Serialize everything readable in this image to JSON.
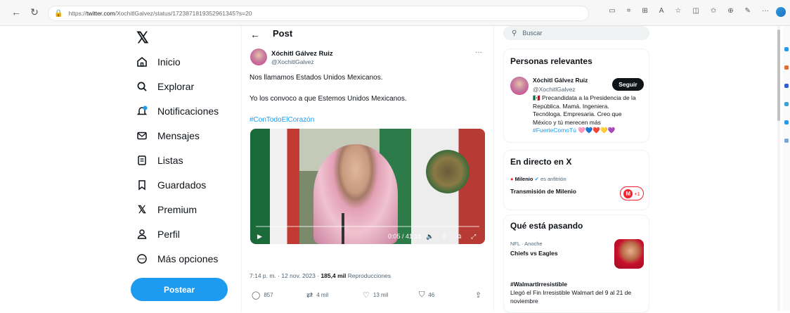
{
  "browser": {
    "url_prefix": "https://",
    "url_host": "twitter.com",
    "url_path": "/XochitlGalvez/status/1723871819352961345?s=20",
    "back_icon": "back-arrow-icon",
    "refresh_icon": "refresh-icon"
  },
  "sidebar": {
    "logo": "𝕏",
    "items": [
      {
        "label": "Inicio",
        "icon": "home-icon"
      },
      {
        "label": "Explorar",
        "icon": "search-icon"
      },
      {
        "label": "Notificaciones",
        "icon": "bell-icon"
      },
      {
        "label": "Mensajes",
        "icon": "mail-icon"
      },
      {
        "label": "Listas",
        "icon": "list-icon"
      },
      {
        "label": "Guardados",
        "icon": "bookmark-icon"
      },
      {
        "label": "Premium",
        "icon": "x-icon"
      },
      {
        "label": "Perfil",
        "icon": "person-icon"
      },
      {
        "label": "Más opciones",
        "icon": "more-circle-icon"
      }
    ],
    "post_button": "Postear"
  },
  "main": {
    "title": "Post",
    "author_name": "Xóchitl Gálvez Ruiz",
    "author_handle": "@XochitlGalvez",
    "text_line1": "Nos llamamos Estados Unidos Mexicanos.",
    "text_line2": "Yo los convoco a que Estemos Unidos Mexicanos.",
    "hashtag": "#ConTodoElCorazón",
    "video_time": "0:05 / 41:16",
    "meta_time": "7:14 p. m. · 12 nov. 2023 · ",
    "meta_views": "185,4 mil",
    "meta_views_label": " Reproducciones",
    "actions": {
      "replies": "857",
      "reposts": "4 mil",
      "likes": "13 mil",
      "bookmarks": "46"
    }
  },
  "right": {
    "search_placeholder": "Buscar",
    "relevant": {
      "title": "Personas relevantes",
      "name": "Xóchitl Gálvez Ruiz",
      "handle": "@XochitlGalvez",
      "follow": "Seguir",
      "bio_line1": "🇲🇽 Precandidata a la Presidencia de la",
      "bio_line2": "República. Mamá. Ingeniera.",
      "bio_line3": "Tecnóloga. Empresaria. Creo que",
      "bio_line4": "México y tú merecen más",
      "bio_hashtag": "#FuerteComoTú",
      "bio_hearts": "🩷💙❤️💛💜"
    },
    "live": {
      "title": "En directo en X",
      "host": "Milenio",
      "host_suffix": "es anfitrión",
      "stream": "Transmisión de Milenio",
      "badge_letter": "M",
      "badge_count": "+1"
    },
    "happening": {
      "title": "Qué está pasando",
      "item1_meta": "NFL · Anoche",
      "item1_title": "Chiefs vs Eagles",
      "item2_title": "#WalmartIrresistible",
      "item2_desc1": "Llegó el Fin Irresistible Walmart del 9 al 21 de",
      "item2_desc2": "noviembre"
    }
  }
}
